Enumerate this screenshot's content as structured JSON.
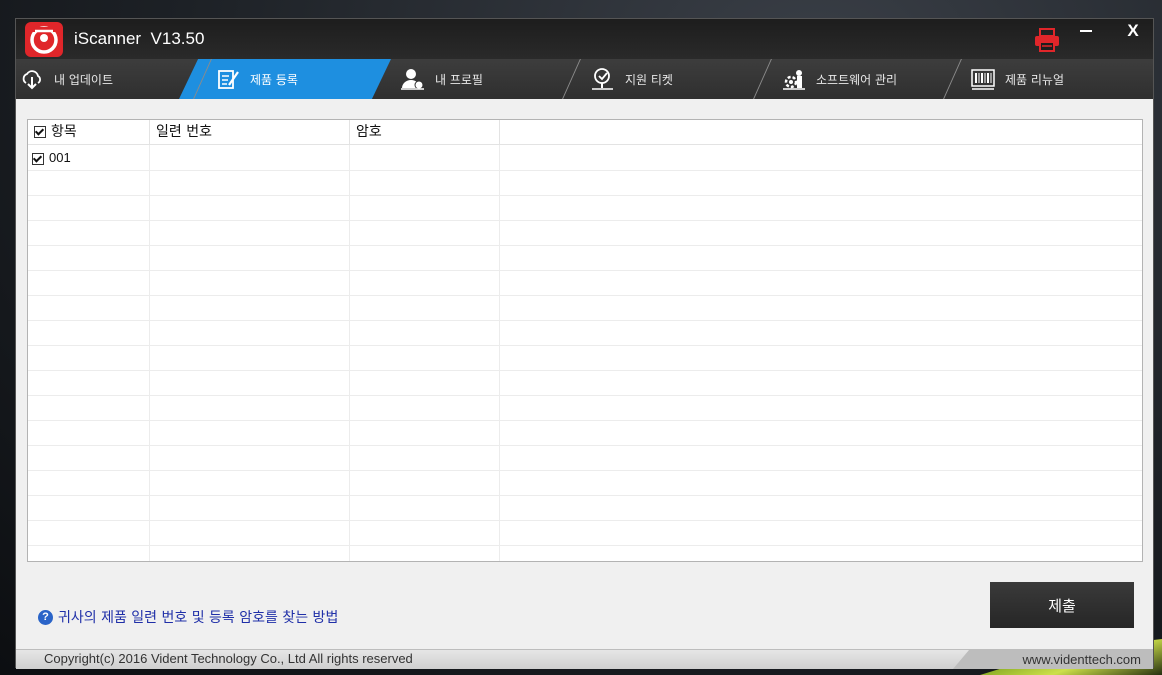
{
  "app": {
    "title": "iScanner  V13.50",
    "close_label": "X"
  },
  "tabs": [
    {
      "label": "내 업데이트",
      "icon": "cloud-download-icon"
    },
    {
      "label": "제품 등록",
      "icon": "register-form-icon",
      "active": true
    },
    {
      "label": "내 프로필",
      "icon": "user-profile-icon"
    },
    {
      "label": "지원 티켓",
      "icon": "support-ticket-icon"
    },
    {
      "label": "소프트웨어 관리",
      "icon": "software-gear-icon"
    },
    {
      "label": "제품 리뉴얼",
      "icon": "barcode-icon"
    }
  ],
  "grid": {
    "columns": [
      "항목",
      "일련 번호",
      "암호"
    ],
    "rows": [
      {
        "item": "001",
        "checked": true,
        "serial": "",
        "password": ""
      }
    ]
  },
  "help_link": "귀사의 제품 일련 번호 및 등록 암호를 찾는 방법",
  "submit_label": "제출",
  "footer": {
    "copyright": "Copyright(c) 2016 Vident Technology Co., Ltd All rights reserved",
    "website": "www.videnttech.com"
  },
  "colors": {
    "active_tab": "#1e8fe0",
    "logo_red": "#e0262a",
    "link_blue": "#1f2fa8"
  }
}
